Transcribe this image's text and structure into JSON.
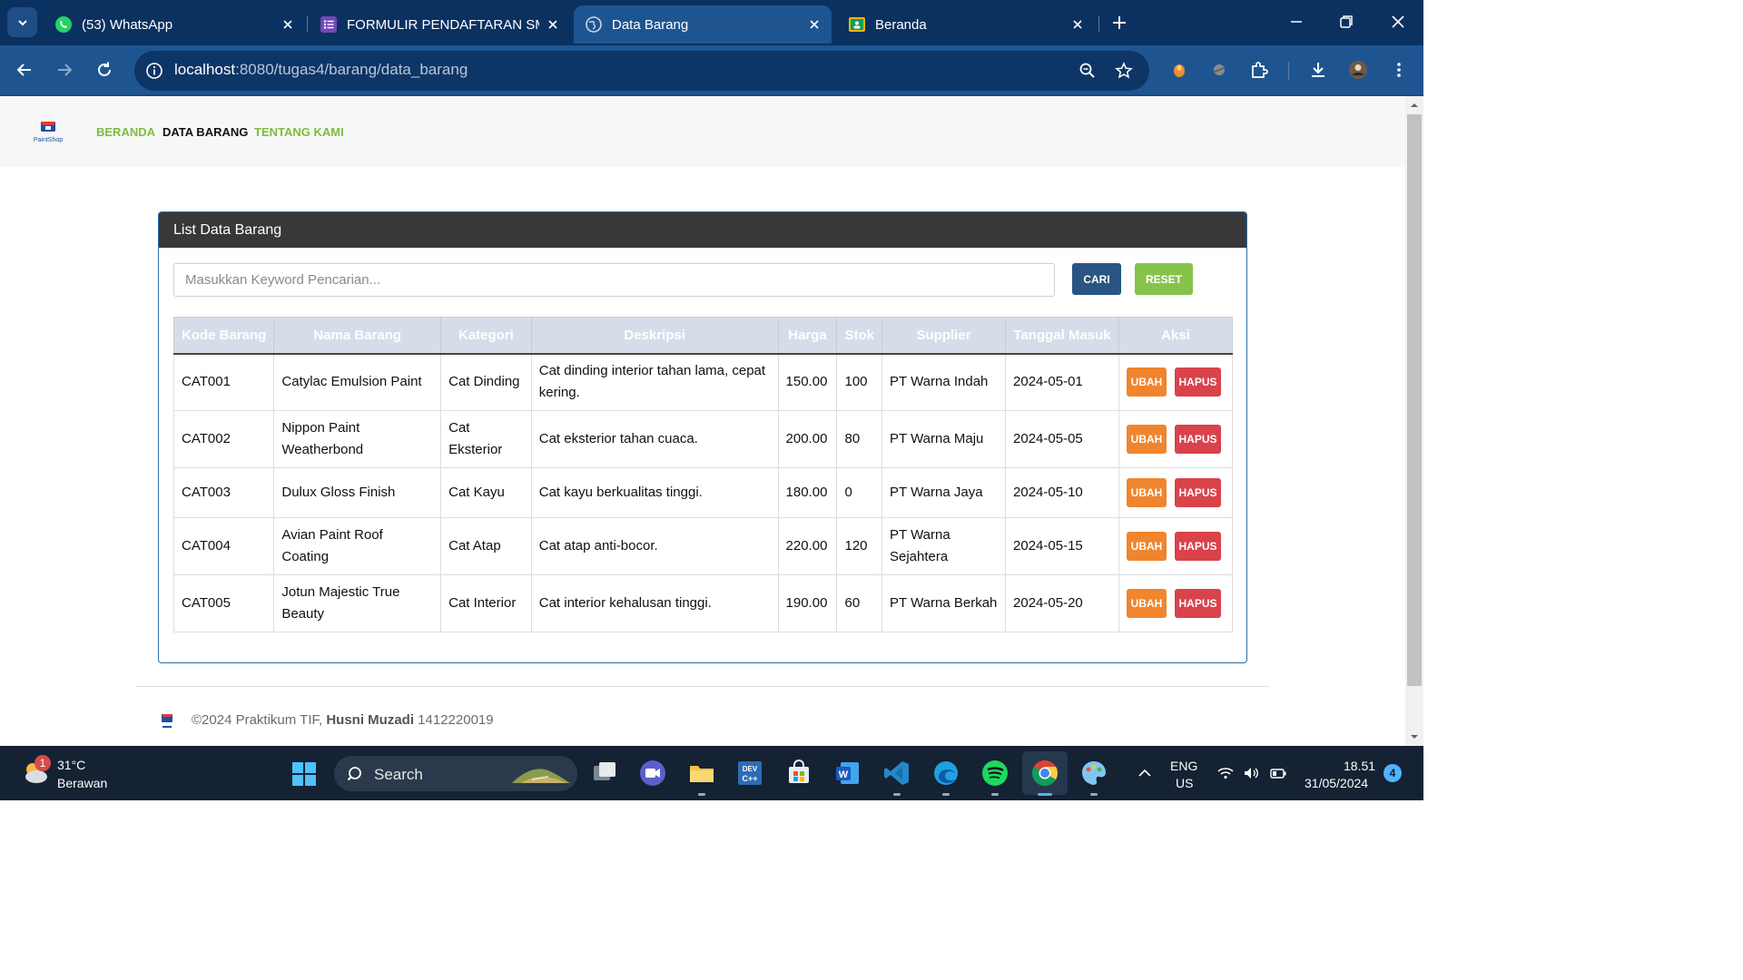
{
  "browser": {
    "tabs": [
      {
        "title": "(53) WhatsApp",
        "icon": "whatsapp-icon",
        "active": false
      },
      {
        "title": "FORMULIR PENDAFTARAN SMP",
        "icon": "forms-icon",
        "active": false
      },
      {
        "title": "Data Barang",
        "icon": "globe-icon",
        "active": true
      },
      {
        "title": "Beranda",
        "icon": "classroom-icon",
        "active": false
      }
    ],
    "url_host": "localhost",
    "url_rest": ":8080/tugas4/barang/data_barang"
  },
  "site": {
    "brand_alt": "PaintShop",
    "nav": [
      {
        "label": "BERANDA",
        "current": false
      },
      {
        "label": "DATA BARANG",
        "current": true
      },
      {
        "label": "TENTANG KAMI",
        "current": false
      }
    ]
  },
  "card": {
    "title": "List Data Barang",
    "search_placeholder": "Masukkan Keyword Pencarian...",
    "search_value": "",
    "cari_label": "CARI",
    "reset_label": "RESET"
  },
  "table": {
    "columns": [
      "Kode Barang",
      "Nama Barang",
      "Kategori",
      "Deskripsi",
      "Harga",
      "Stok",
      "Supplier",
      "Tanggal Masuk",
      "Aksi"
    ],
    "rows": [
      {
        "kode": "CAT001",
        "nama": "Catylac Emulsion Paint",
        "kategori": "Cat Dinding",
        "deskripsi": "Cat dinding interior tahan lama, cepat kering.",
        "harga": "150.00",
        "stok": "100",
        "supplier": "PT Warna Indah",
        "tanggal": "2024-05-01"
      },
      {
        "kode": "CAT002",
        "nama": "Nippon Paint Weatherbond",
        "kategori": "Cat Eksterior",
        "deskripsi": "Cat eksterior tahan cuaca.",
        "harga": "200.00",
        "stok": "80",
        "supplier": "PT Warna Maju",
        "tanggal": "2024-05-05"
      },
      {
        "kode": "CAT003",
        "nama": "Dulux Gloss Finish",
        "kategori": "Cat Kayu",
        "deskripsi": "Cat kayu berkualitas tinggi.",
        "harga": "180.00",
        "stok": "0",
        "supplier": "PT Warna Jaya",
        "tanggal": "2024-05-10"
      },
      {
        "kode": "CAT004",
        "nama": "Avian Paint Roof Coating",
        "kategori": "Cat Atap",
        "deskripsi": "Cat atap anti-bocor.",
        "harga": "220.00",
        "stok": "120",
        "supplier": "PT Warna Sejahtera",
        "tanggal": "2024-05-15"
      },
      {
        "kode": "CAT005",
        "nama": "Jotun Majestic True Beauty",
        "kategori": "Cat Interior",
        "deskripsi": "Cat interior kehalusan tinggi.",
        "harga": "190.00",
        "stok": "60",
        "supplier": "PT Warna Berkah",
        "tanggal": "2024-05-20"
      }
    ],
    "ubah_label": "UBAH",
    "hapus_label": "HAPUS"
  },
  "footer": {
    "prefix": "©2024 Praktikum TIF, ",
    "author": "Husni Muzadi",
    "nim": " 1412220019"
  },
  "taskbar": {
    "weather_temp": "31°C",
    "weather_desc": "Berawan",
    "weather_badge": "1",
    "search_label": "Search",
    "lang_line1": "ENG",
    "lang_line2": "US",
    "time": "18.51",
    "date": "31/05/2024",
    "notifications": "4"
  },
  "colors": {
    "tabbar": "#0b3160",
    "toolbar": "#1e5591",
    "card_header": "#383838",
    "nav_link": "#7bbd3f",
    "cari_button": "#2a5582",
    "reset_button": "#86c34b",
    "ubah_button": "#f0852e",
    "hapus_button": "#d9434b"
  }
}
